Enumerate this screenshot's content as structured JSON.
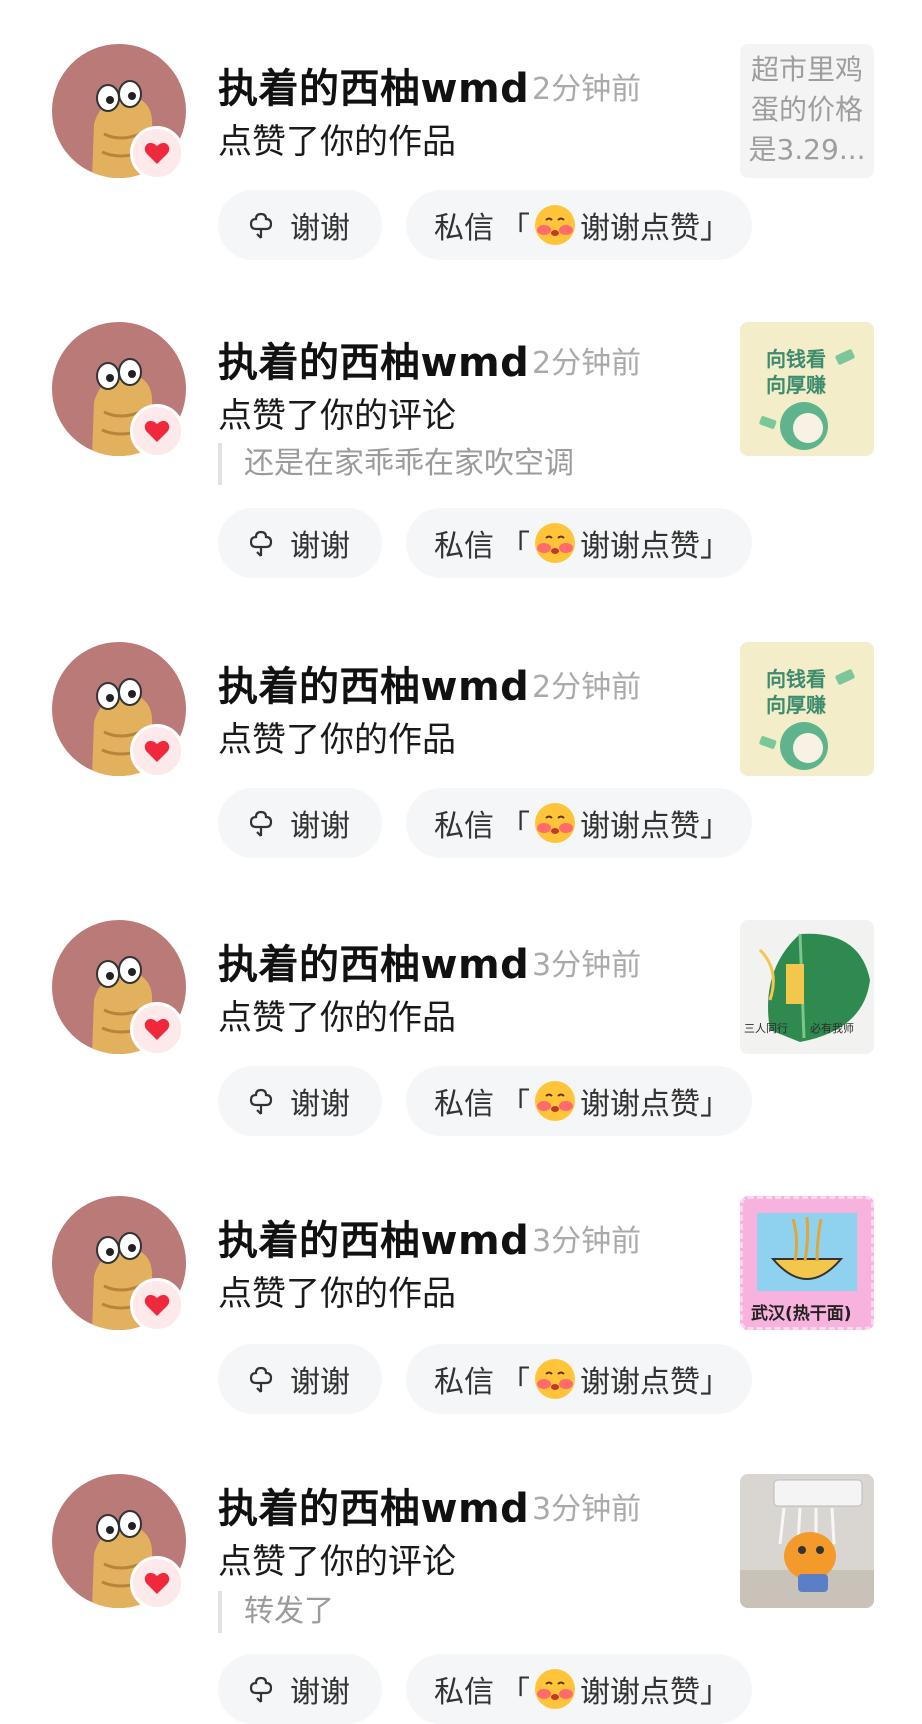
{
  "notifications": [
    {
      "user": "执着的西柚wmd",
      "time": "2分钟前",
      "action": "点赞了你的作品",
      "quote": "",
      "thumb": {
        "kind": "text",
        "lines": [
          "超市里鸡",
          "蛋的价格",
          "是3.29..."
        ]
      }
    },
    {
      "user": "执着的西柚wmd",
      "time": "2分钟前",
      "action": "点赞了你的评论",
      "quote": "还是在家乖乖在家吹空调",
      "thumb": {
        "kind": "money",
        "lines": [
          "向钱看",
          "向厚赚"
        ]
      }
    },
    {
      "user": "执着的西柚wmd",
      "time": "2分钟前",
      "action": "点赞了你的作品",
      "quote": "",
      "thumb": {
        "kind": "money",
        "lines": [
          "向钱看",
          "向厚赚"
        ]
      }
    },
    {
      "user": "执着的西柚wmd",
      "time": "3分钟前",
      "action": "点赞了你的作品",
      "quote": "",
      "thumb": {
        "kind": "leaf",
        "lines": [
          "三人同行",
          "必有我师"
        ]
      }
    },
    {
      "user": "执着的西柚wmd",
      "time": "3分钟前",
      "action": "点赞了你的作品",
      "quote": "",
      "thumb": {
        "kind": "noodle",
        "lines": [
          "武汉(热干面)"
        ]
      }
    },
    {
      "user": "执着的西柚wmd",
      "time": "3分钟前",
      "action": "点赞了你的评论",
      "quote": "转发了",
      "thumb": {
        "kind": "cat",
        "lines": []
      }
    }
  ],
  "buttons": {
    "thanks": "谢谢",
    "dm_prefix": "私信",
    "dm_open": "「",
    "dm_text": "谢谢点赞",
    "dm_close": "」"
  },
  "colors": {
    "avatar_bg": "#b97a78",
    "heart": "#f0283c",
    "button_bg": "#f5f6f7",
    "muted_text": "#aaaaaa"
  },
  "icons": {
    "thanks": "flower-outline-icon",
    "emoji": "blushing-thanks-emoji",
    "badge": "heart-icon"
  }
}
